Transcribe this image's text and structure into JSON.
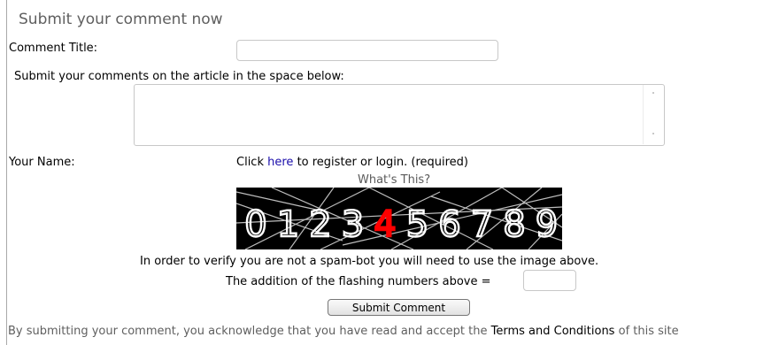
{
  "form": {
    "heading": "Submit your comment now",
    "comment_title_label": "Comment Title:",
    "comment_title_value": "",
    "comments_prompt": "Submit your comments on the article in the space below:",
    "comments_value": "",
    "your_name_label": "Your Name:",
    "register_prefix": "Click",
    "register_link": "here",
    "register_suffix": "to register or login. (required)",
    "whats_this_link": "What's This?",
    "captcha": {
      "digits": [
        "0",
        "1",
        "2",
        "3",
        "4",
        "5",
        "6",
        "7",
        "8",
        "9"
      ],
      "highlighted_digits": [
        "4"
      ],
      "digit_color": "#ffffff",
      "highlight_color": "#ff0000",
      "background": "#000000"
    },
    "verify_text": "In order to verify you are not a spam-bot you will need to use the image above.",
    "addition_label": "The addition of the flashing numbers above =",
    "addition_value": "",
    "submit_label": "Submit Comment"
  },
  "footer": {
    "prefix": "By submitting your comment, you acknowledge that you have read and accept the",
    "terms_link": "Terms and Conditions",
    "suffix": "of this site"
  }
}
